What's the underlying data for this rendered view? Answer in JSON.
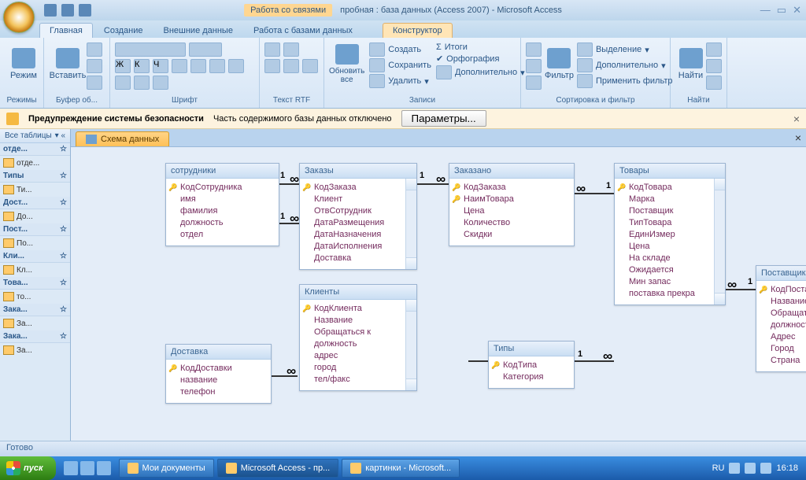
{
  "title": {
    "tools": "Работа со связями",
    "doc": "пробная : база данных (Access 2007) - Microsoft Access"
  },
  "tabs": {
    "home": "Главная",
    "create": "Создание",
    "external": "Внешние данные",
    "dbtools": "Работа с базами данных",
    "design": "Конструктор"
  },
  "ribbon": {
    "g1": "Режимы",
    "b_view": "Режим",
    "g2": "Буфер об...",
    "b_paste": "Вставить",
    "g3": "Шрифт",
    "g4": "Текст RTF",
    "g5": "Записи",
    "b_refresh": "Обновить\nвсе",
    "b_new": "Создать",
    "b_save": "Сохранить",
    "b_delete": "Удалить",
    "b_totals": "Итоги",
    "b_spell": "Орфография",
    "b_more": "Дополнительно",
    "g6": "Сортировка и фильтр",
    "b_filter": "Фильтр",
    "b_sel": "Выделение",
    "b_adv": "Дополнительно",
    "b_toggle": "Применить фильтр",
    "g7": "Найти",
    "b_find": "Найти"
  },
  "security": {
    "title": "Предупреждение системы безопасности",
    "msg": "Часть содержимого базы данных отключено",
    "btn": "Параметры..."
  },
  "nav": {
    "header": "Все таблицы",
    "groups": [
      {
        "name": "отде...",
        "items": [
          "отде..."
        ]
      },
      {
        "name": "Типы",
        "items": [
          "Ти..."
        ]
      },
      {
        "name": "Дост...",
        "items": [
          "До..."
        ]
      },
      {
        "name": "Пост...",
        "items": [
          "По..."
        ]
      },
      {
        "name": "Кли...",
        "items": [
          "Кл..."
        ]
      },
      {
        "name": "Това...",
        "items": [
          "то..."
        ]
      },
      {
        "name": "Зака...",
        "items": [
          "За..."
        ]
      },
      {
        "name": "Зака...",
        "items": [
          "За..."
        ]
      }
    ]
  },
  "doctab": "Схема данных",
  "tables": {
    "sotrudniki": {
      "title": "сотрудники",
      "fields": [
        "КодСотрудника",
        "имя",
        "фамилия",
        "должность",
        "отдел"
      ],
      "keys": [
        0
      ]
    },
    "zakazy": {
      "title": "Заказы",
      "fields": [
        "КодЗаказа",
        "Клиент",
        "ОтвСотрудник",
        "ДатаРазмещения",
        "ДатаНазначения",
        "ДатаИсполнения",
        "Доставка"
      ],
      "keys": [
        0
      ]
    },
    "zakazano": {
      "title": "Заказано",
      "fields": [
        "КодЗаказа",
        "НаимТовара",
        "Цена",
        "Количество",
        "Скидки"
      ],
      "keys": [
        0,
        1
      ]
    },
    "tovary": {
      "title": "Товары",
      "fields": [
        "КодТовара",
        "Марка",
        "Поставщик",
        "ТипТовара",
        "ЕдинИзмер",
        "Цена",
        "На складе",
        "Ожидается",
        "Мин запас",
        "поставка прекра"
      ],
      "keys": [
        0
      ]
    },
    "postavshiki": {
      "title": "Поставщики",
      "fields": [
        "КодПоставщика",
        "Название",
        "Обращаться к",
        "должность",
        "Адрес",
        "Город",
        "Страна"
      ],
      "keys": [
        0
      ]
    },
    "klienty": {
      "title": "Клиенты",
      "fields": [
        "КодКлиента",
        "Название",
        "Обращаться к",
        "должность",
        "адрес",
        "город",
        "тел/факс"
      ],
      "keys": [
        0
      ]
    },
    "dostavka": {
      "title": "Доставка",
      "fields": [
        "КодДоставки",
        "название",
        "телефон"
      ],
      "keys": [
        0
      ]
    },
    "tipy": {
      "title": "Типы",
      "fields": [
        "КодТипа",
        "Категория"
      ],
      "keys": [
        0
      ]
    }
  },
  "status": "Готово",
  "taskbar": {
    "start": "пуск",
    "items": [
      "Мои документы",
      "Microsoft Access - пр...",
      "картинки - Microsoft..."
    ],
    "lang": "RU",
    "time": "16:18"
  }
}
